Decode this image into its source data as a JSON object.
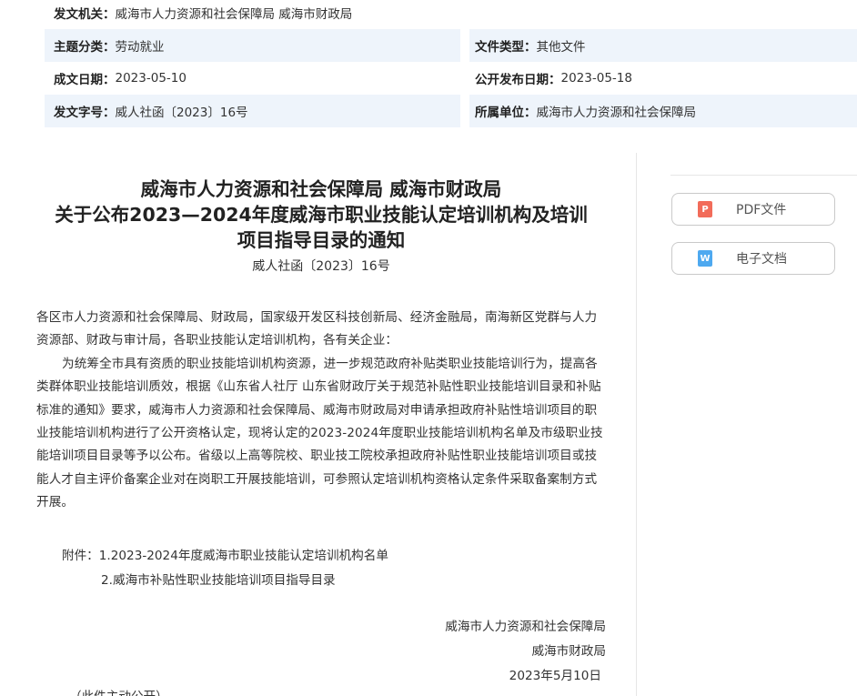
{
  "meta": {
    "issuer_key": "发文机关：",
    "issuer_val": "威海市人力资源和社会保障局 威海市财政局",
    "topic_key": "主题分类：",
    "topic_val": "劳动就业",
    "type_key": "文件类型：",
    "type_val": "其他文件",
    "date_key": "成文日期：",
    "date_val": "2023-05-10",
    "pub_key": "公开发布日期：",
    "pub_val": "2023-05-18",
    "docno_key": "发文字号：",
    "docno_val": "威人社函〔2023〕16号",
    "unit_key": "所属单位：",
    "unit_val": "威海市人力资源和社会保障局"
  },
  "side": {
    "pdf_label": "PDF文件",
    "pdf_icon": "P",
    "doc_label": "电子文档",
    "doc_icon": "W"
  },
  "title": {
    "line1": "威海市人力资源和社会保障局 威海市财政局",
    "line2": "关于公布2023—2024年度威海市职业技能认定培训机构及培训",
    "line3": "项目指导目录的通知",
    "doc_no": "威人社函〔2023〕16号"
  },
  "body": {
    "p1": "各区市人力资源和社会保障局、财政局，国家级开发区科技创新局、经济金融局，南海新区党群与人力资源部、财政与审计局，各职业技能认定培训机构，各有关企业：",
    "p2": "为统筹全市具有资质的职业技能培训机构资源，进一步规范政府补贴类职业技能培训行为，提高各类群体职业技能培训质效，根据《山东省人社厅 山东省财政厅关于规范补贴性职业技能培训目录和补贴标准的通知》要求，威海市人力资源和社会保障局、威海市财政局对申请承担政府补贴性培训项目的职业技能培训机构进行了公开资格认定，现将认定的2023-2024年度职业技能培训机构名单及市级职业技能培训项目目录等予以公布。省级以上高等院校、职业技工院校承担政府补贴性职业技能培训项目或技能人才自主评价备案企业对在岗职工开展技能培训，可参照认定培训机构资格认定条件采取备案制方式开展。"
  },
  "attach": {
    "line1": "附件：1.2023-2024年度威海市职业技能认定培训机构名单",
    "line2": "2.威海市补贴性职业技能培训项目指导目录"
  },
  "sign": {
    "org1": "威海市人力资源和社会保障局",
    "org2": "威海市财政局",
    "date": "2023年5月10日"
  },
  "foot": {
    "note": "（此件主动公开）"
  }
}
